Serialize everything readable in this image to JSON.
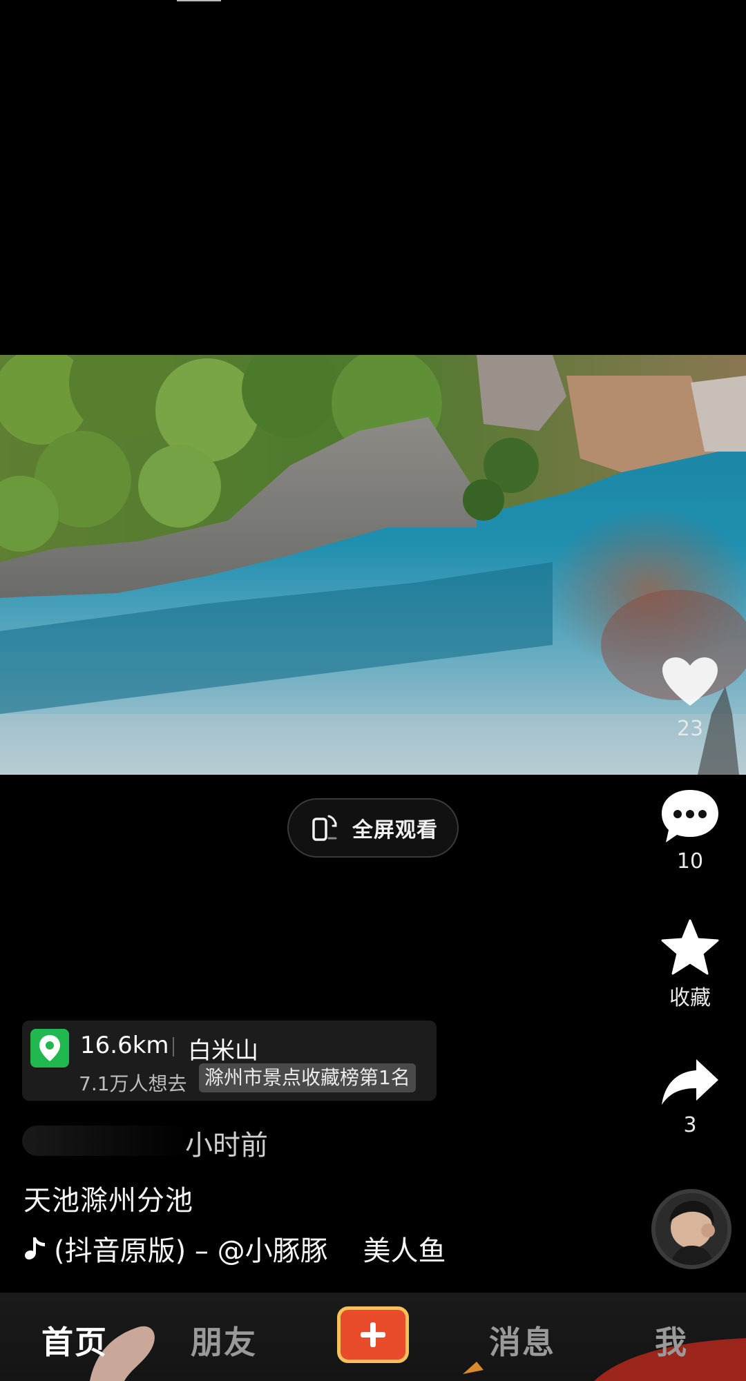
{
  "video": {
    "fullscreen_label": "全屏观看"
  },
  "actions": {
    "like_count": "23",
    "comment_count": "10",
    "favorite_label": "收藏",
    "share_count": "3"
  },
  "poi": {
    "distance": "16.6km",
    "name": "白米山",
    "wants": "7.1万人想去",
    "rank_badge": "滁州市景点收藏榜第1名"
  },
  "post": {
    "time_ago": "小时前",
    "caption": "天池滁州分池",
    "music": "(抖音原版) – @小豚豚    美人鱼"
  },
  "nav": {
    "tabs": [
      "首页",
      "朋友",
      "消息",
      "我"
    ],
    "active_tab": "首页"
  },
  "colors": {
    "poi_pin": "#21b84f",
    "add_button_fill": "#e94c2b",
    "add_button_border": "#f6c15a",
    "water": "#1f8aa6"
  },
  "icons": [
    "fullscreen-rotate-icon",
    "heart-icon",
    "comment-bubble-icon",
    "star-icon",
    "share-arrow-icon",
    "location-pin-icon",
    "music-note-icon",
    "plus-icon"
  ]
}
